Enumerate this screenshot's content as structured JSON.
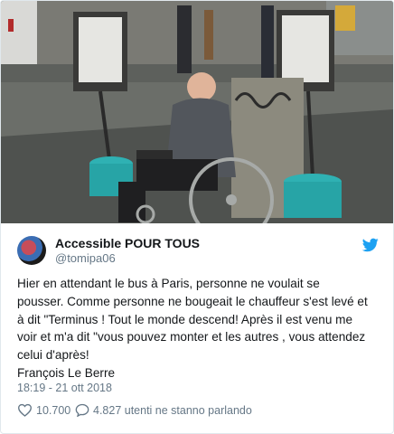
{
  "tweet": {
    "author_name": "Accessible POUR TOUS",
    "author_handle": "@tomipa06",
    "text_lines": [
      "Hier en attendant le bus à Paris, personne ne voulait se",
      "pousser. Comme personne ne bougeait le chauffeur s'est levé et",
      "à dit \"Terminus ! Tout le monde descend! Après il est venu me",
      "voir et m'a dit \"vous pouvez monter et les autres , vous attendez",
      "celui d'après!",
      "François Le Berre"
    ],
    "timestamp": "18:19 - 21 ott 2018",
    "like_count": "10.700",
    "talking_text": "4.827 utenti ne stanno parlando"
  },
  "colors": {
    "text": "#14171a",
    "secondary": "#657786",
    "twitter_blue": "#1da1f2",
    "border": "#e1e8ed"
  },
  "icons": {
    "brand": "twitter-bird-icon",
    "like": "heart-icon",
    "reply": "speech-bubble-icon"
  }
}
